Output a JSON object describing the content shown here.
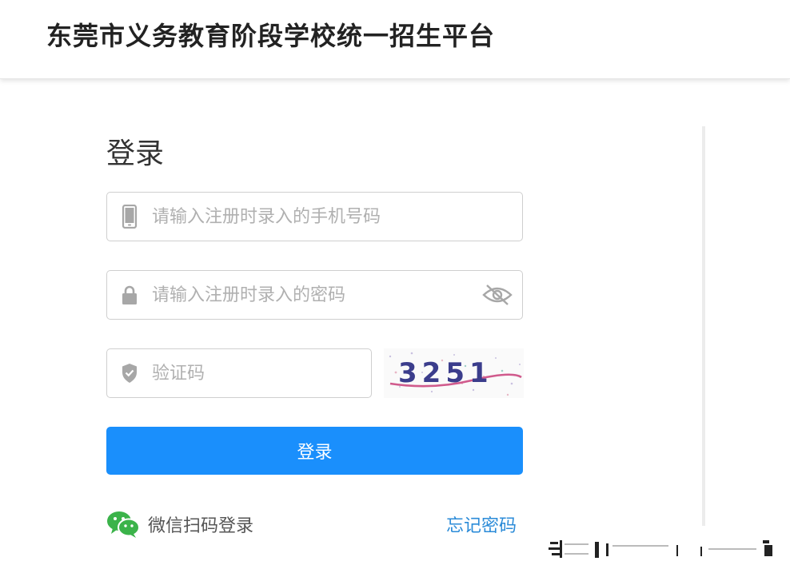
{
  "header": {
    "title": "东莞市义务教育阶段学校统一招生平台"
  },
  "login": {
    "title": "登录",
    "phone": {
      "placeholder": "请输入注册时录入的手机号码",
      "value": "",
      "icon": "phone-icon"
    },
    "password": {
      "placeholder": "请输入注册时录入的密码",
      "value": "",
      "icon": "lock-icon",
      "toggle_icon": "eye-off-icon"
    },
    "captcha": {
      "placeholder": "验证码",
      "value": "",
      "icon": "shield-icon",
      "image_text": "3251"
    },
    "submit_label": "登录",
    "wechat_label": "微信扫码登录",
    "forgot_label": "忘记密码"
  },
  "colors": {
    "primary": "#1a8ffc",
    "link": "#2b8bd8",
    "wechat": "#3bb34a",
    "placeholder": "#b0b0b0"
  }
}
